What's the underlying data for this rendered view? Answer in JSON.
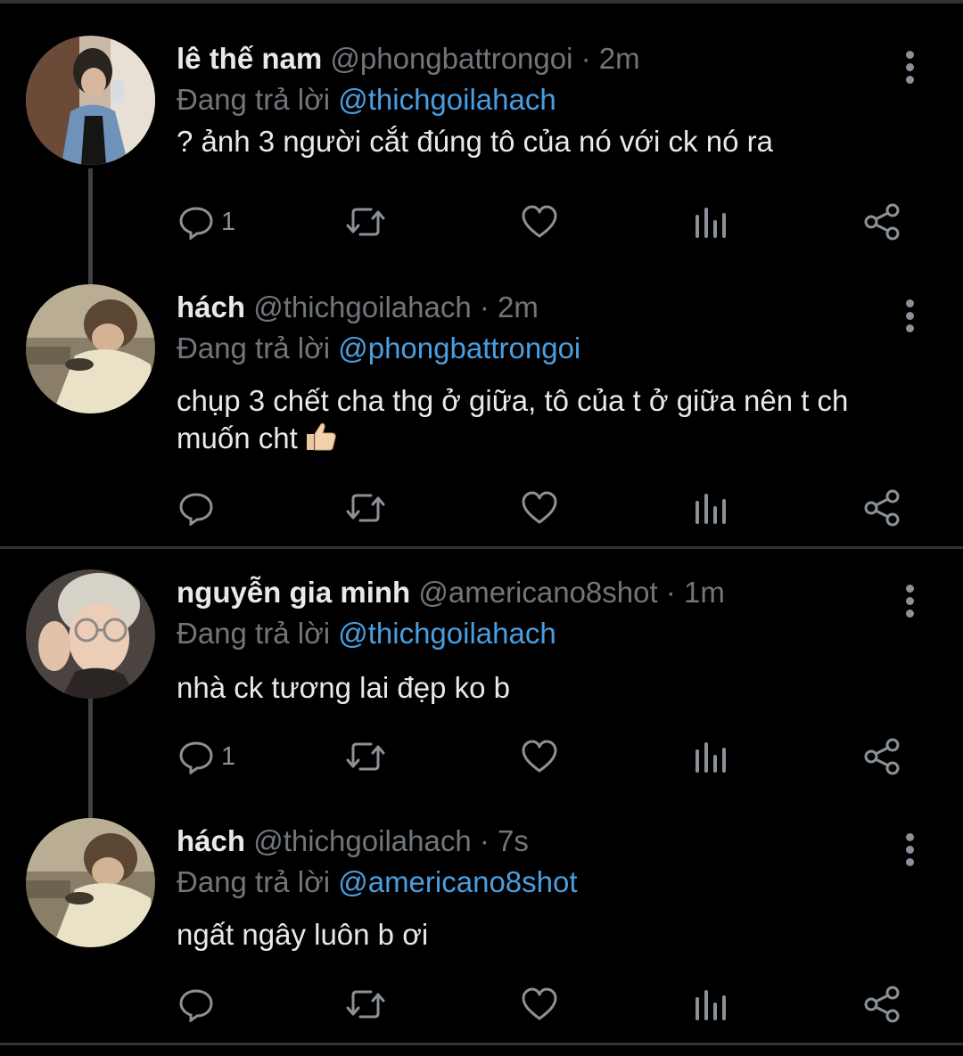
{
  "tweets": [
    {
      "name": "lê thế nam",
      "handle": "@phongbattrongoi",
      "separator": "·",
      "time": "2m",
      "reply_prefix": "Đang trả lời",
      "reply_to": "@thichgoilahach",
      "text": "? ảnh 3 người cắt đúng tô của nó với ck nó ra",
      "reply_count": "1"
    },
    {
      "name": "hách",
      "handle": "@thichgoilahach",
      "separator": "·",
      "time": "2m",
      "reply_prefix": "Đang trả lời",
      "reply_to": "@phongbattrongoi",
      "text_line1": "chụp 3 chết cha thg ở giữa, tô của t ở giữa nên t ch",
      "text_line2": "muốn cht",
      "emoji": "thumbs-up",
      "reply_count": ""
    },
    {
      "name": "nguyễn gia minh",
      "handle": "@americano8shot",
      "separator": "·",
      "time": "1m",
      "reply_prefix": "Đang trả lời",
      "reply_to": "@thichgoilahach",
      "text": "nhà ck tương lai đẹp ko b",
      "reply_count": "1"
    },
    {
      "name": "hách",
      "handle": "@thichgoilahach",
      "separator": "·",
      "time": "7s",
      "reply_prefix": "Đang trả lời",
      "reply_to": "@americano8shot",
      "text": "ngất ngây luôn b ơi",
      "reply_count": ""
    }
  ],
  "icons": [
    "reply-icon",
    "retweet-icon",
    "like-icon",
    "analytics-icon",
    "share-icon",
    "more-options-icon"
  ],
  "colors": {
    "background": "#000000",
    "text_primary": "#e7e9ea",
    "text_secondary": "#71767b",
    "mention": "#4a9ee0",
    "divider": "#2f3336",
    "thread_line": "#3d4145"
  }
}
